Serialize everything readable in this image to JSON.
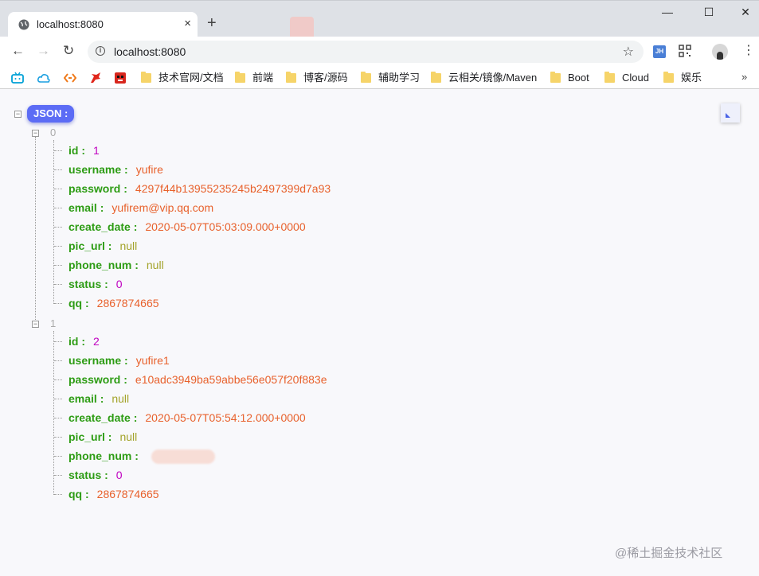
{
  "browser": {
    "tab_title": "localhost:8080",
    "tab_close": "×",
    "new_tab": "+",
    "url": "localhost:8080",
    "window_controls": [
      "—",
      "☐",
      "✕"
    ],
    "nav": {
      "back": "←",
      "forward": "→",
      "reload": "↻"
    },
    "star": "☆",
    "extension_label": "JH",
    "menu": "⋮",
    "more_bookmarks": "»"
  },
  "bookmarks": [
    {
      "label": "技术官网/文档"
    },
    {
      "label": "前端"
    },
    {
      "label": "博客/源码"
    },
    {
      "label": "辅助学习"
    },
    {
      "label": "云相关/镜像/Maven"
    },
    {
      "label": "Boot"
    },
    {
      "label": "Cloud"
    },
    {
      "label": "娱乐"
    }
  ],
  "viewer": {
    "root_label": "JSON :",
    "collapse_symbol": "−",
    "items": [
      {
        "index": "0",
        "fields": [
          {
            "key": "id :",
            "value": "1",
            "type": "num"
          },
          {
            "key": "username :",
            "value": "yufire",
            "type": "str"
          },
          {
            "key": "password :",
            "value": "4297f44b13955235245b2497399d7a93",
            "type": "str"
          },
          {
            "key": "email :",
            "value": "yufirem@vip.qq.com",
            "type": "str"
          },
          {
            "key": "create_date :",
            "value": "2020-05-07T05:03:09.000+0000",
            "type": "str"
          },
          {
            "key": "pic_url :",
            "value": "null",
            "type": "nul"
          },
          {
            "key": "phone_num :",
            "value": "null",
            "type": "nul"
          },
          {
            "key": "status :",
            "value": "0",
            "type": "num"
          },
          {
            "key": "qq :",
            "value": "2867874665",
            "type": "str"
          }
        ]
      },
      {
        "index": "1",
        "fields": [
          {
            "key": "id :",
            "value": "2",
            "type": "num"
          },
          {
            "key": "username :",
            "value": "yufire1",
            "type": "str"
          },
          {
            "key": "password :",
            "value": "e10adc3949ba59abbe56e057f20f883e",
            "type": "str"
          },
          {
            "key": "email :",
            "value": "null",
            "type": "nul"
          },
          {
            "key": "create_date :",
            "value": "2020-05-07T05:54:12.000+0000",
            "type": "str"
          },
          {
            "key": "pic_url :",
            "value": "null",
            "type": "nul"
          },
          {
            "key": "phone_num :",
            "value": "",
            "type": "blur"
          },
          {
            "key": "status :",
            "value": "0",
            "type": "num"
          },
          {
            "key": "qq :",
            "value": "2867874665",
            "type": "str"
          }
        ]
      }
    ]
  },
  "watermark": "@稀土掘金技术社区",
  "colors": {
    "key": "#2d9c14",
    "number": "#c000c0",
    "string": "#e8612c",
    "null": "#a3a32a",
    "badge": "#5c6cf5"
  }
}
